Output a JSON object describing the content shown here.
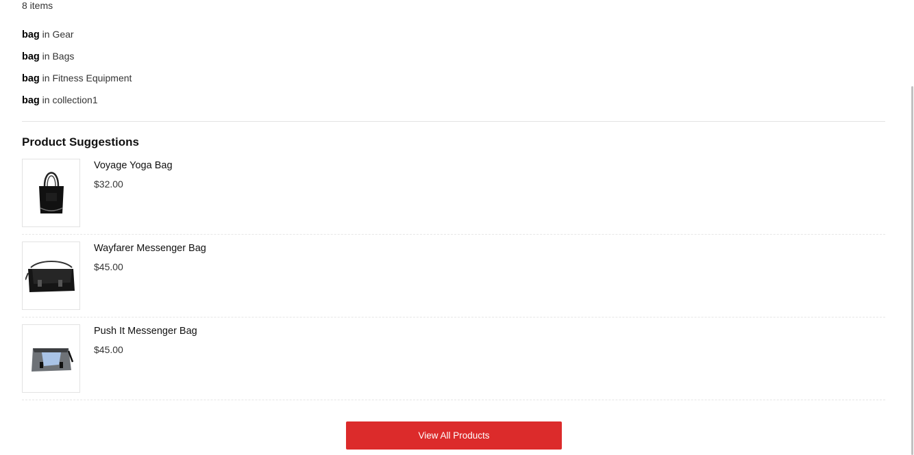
{
  "items_count": "8 items",
  "suggestions": [
    {
      "term": "bag",
      "connector": "in",
      "category": "Gear"
    },
    {
      "term": "bag",
      "connector": "in",
      "category": "Bags"
    },
    {
      "term": "bag",
      "connector": "in",
      "category": "Fitness Equipment"
    },
    {
      "term": "bag",
      "connector": "in",
      "category": "collection1"
    }
  ],
  "section_title": "Product Suggestions",
  "products": [
    {
      "name": "Voyage Yoga Bag",
      "price": "$32.00",
      "icon": "tote-bag-icon"
    },
    {
      "name": "Wayfarer Messenger Bag",
      "price": "$45.00",
      "icon": "messenger-bag-icon"
    },
    {
      "name": "Push It Messenger Bag",
      "price": "$45.00",
      "icon": "messenger-bag-icon"
    }
  ],
  "view_all_label": "View All Products",
  "colors": {
    "accent": "#dc2b2b",
    "divider": "#e3e3e3",
    "text": "#333333"
  }
}
